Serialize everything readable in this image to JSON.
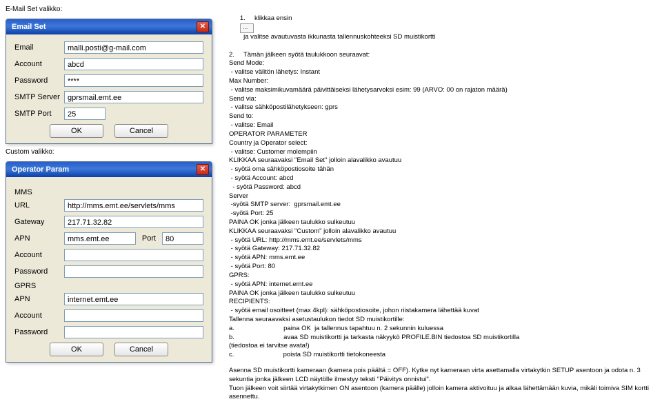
{
  "left": {
    "emailSetLabel": "E-Mail Set valikko:",
    "customLabel": "Custom valikko:",
    "emailWin": {
      "title": "Email Set",
      "fields": {
        "emailLbl": "Email",
        "emailVal": "malli.posti@g-mail.com",
        "accountLbl": "Account",
        "accountVal": "abcd",
        "passwordLbl": "Password",
        "passwordVal": "****",
        "smtpLbl": "SMTP Server",
        "smtpVal": "gprsmail.emt.ee",
        "portLbl": "SMTP Port",
        "portVal": "25"
      },
      "okLabel": "OK",
      "cancelLabel": "Cancel"
    },
    "opWin": {
      "title": "Operator Param",
      "mmsLbl": "MMS",
      "urlLbl": "URL",
      "urlVal": "http://mms.emt.ee/servlets/mms",
      "gwLbl": "Gateway",
      "gwVal": "217.71.32.82",
      "apnLbl": "APN",
      "apnVal": "mms.emt.ee",
      "portLbl": "Port",
      "portVal": "80",
      "acctLbl": "Account",
      "acctVal": "",
      "pwdLbl": "Password",
      "pwdVal": "",
      "gprsLbl": "GPRS",
      "apn2Lbl": "APN",
      "apn2Val": "internet.emt.ee",
      "acct2Lbl": "Account",
      "acct2Val": "",
      "pwd2Lbl": "Password",
      "pwd2Val": "",
      "okLabel": "OK",
      "cancelLabel": "Cancel"
    }
  },
  "right": {
    "l1": "1.     klikkaa ensin  ",
    "l1b": "  ja valitse avautuvasta ikkunasta tallennuskohteeksi SD muistikortti",
    "l2": "2.     Tämän jälkeen syötä taulukkoon seuraavat:",
    "l3": "Send Mode:",
    "l4": " - valitse välitön lähetys: Instant",
    "l5": "Max Number:",
    "l6": " - valitse maksimikuvamäärä päivittäiseksi lähetysarvoksi esim: 99 (ARVO: 00 on rajaton määrä)",
    "l7": "Send via:",
    "l8": " - valitse sähköpostilähetykseen: gprs",
    "l9": "Send to:",
    "l10": " - valitse: Email",
    "l11": "OPERATOR PARAMETER",
    "l12": "Country ja Operator select:",
    "l13": " - valitse: Customer molempiin",
    "l14": "KLIKKAA seuraavaksi \"Email Set\" jolloin alavalikko avautuu",
    "l15": " - syötä oma sähköpostiosoite tähän",
    "l16": " - syötä Account: abcd",
    "l17": "  - syötä Password: abcd",
    "l18": "Server",
    "l19": " -syötä SMTP server:  gprsmail.emt.ee",
    "l20": " -syötä Port: 25",
    "l21": "PAINA OK jonka jälkeen taulukko sulkeutuu",
    "l22": "KLIKKAA seuraavaksi \"Custom\" jolloin alavalikko avautuu",
    "l23": " - syötä URL: http://mms.emt.ee/servlets/mms",
    "l24": " - syötä Gateway: 217.71.32.82",
    "l25": " - syötä APN: mms.emt.ee",
    "l26": " - syötä Port: 80",
    "l27": "GPRS:",
    "l28": " - syötä APN: internet.emt.ee",
    "l29": "PAINA OK jonka jälkeen taulukko sulkeutuu",
    "l30": "RECIPIENTS:",
    "l31": " - syötä email osoitteet (max 4kpl): sähköpostiosoite, johon riistakamera lähettää kuvat",
    "l32": "Tallenna seuraavaksi asetustaulukon tiedot SD muistikortille:",
    "l33": "a.                           paina OK  ja tallennus tapahtuu n. 2 sekunnin kuluessa",
    "l34": "b.                           avaa SD muistikortti ja tarkasta näkyykö PROFILE.BIN tiedostoa SD muistikortilla",
    "l35": "(tiedostoa ei tarvitse avata!)",
    "l36": "c.                           poista SD muistikortti tietokoneesta",
    "p2a": "Asenna SD muistikortti kameraan (kamera pois päältä = OFF). Kytke nyt kameraan virta asettamalla virtakytkin SETUP asentoon ja odota n. 3 sekuntia jonka jälkeen LCD näytölle ilmestyy teksti \"Päivitys onnistui\".",
    "p2b": "Tuon jälkeen voit siirtää virtakytkimen ON asentoon (kamera päälle) jolloin kamera aktivoituu ja alkaa lähettämään kuvia, mikäli toimiva SIM kortti asennettu."
  }
}
